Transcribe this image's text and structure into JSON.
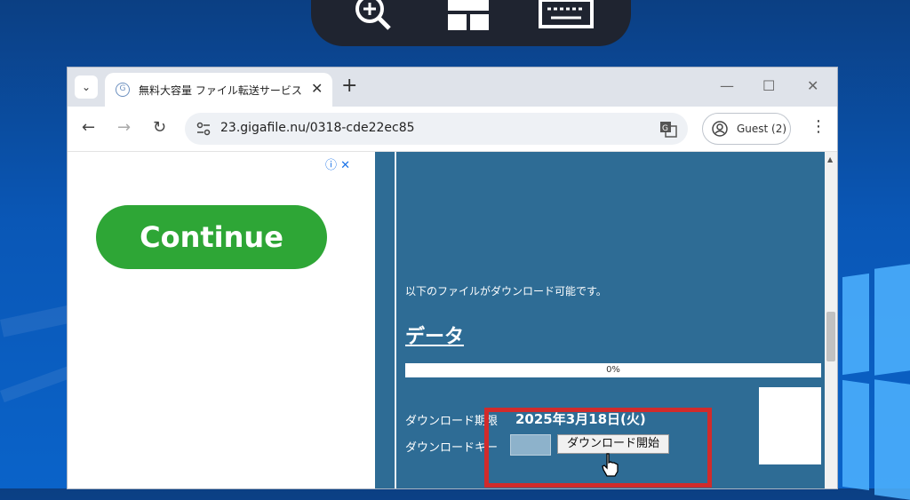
{
  "overlay_toolbar": {
    "icons": [
      "zoom-in-icon",
      "layout-icon",
      "keyboard-icon"
    ]
  },
  "browser": {
    "tab": {
      "title": "無料大容量 ファイル転送サービス G",
      "close": "✕"
    },
    "new_tab": "+",
    "window_controls": {
      "minimize": "—",
      "maximize": "☐",
      "close": "✕"
    },
    "nav": {
      "back": "←",
      "forward": "→",
      "reload": "↻"
    },
    "url": "23.gigafile.nu/0318-cde22ec85",
    "profile": {
      "label": "Guest (2)"
    },
    "menu": "⋮"
  },
  "ad": {
    "controls": "ⓘ ✕",
    "cta_label": "Continue"
  },
  "page": {
    "download_message": "以下のファイルがダウンロード可能です。",
    "file_title": "データ",
    "progress_text": "0%",
    "progress_fraction": 0.0,
    "deadline_label": "ダウンロード期限",
    "deadline_value": "2025年3月18日(火)",
    "key_label": "ダウンロードキー",
    "key_value": "",
    "download_button": "ダウンロード開始"
  },
  "colors": {
    "desktop": "#0a57b6",
    "page_bg": "#2e6c95",
    "continue_green": "#2ea636",
    "highlight_red": "#d12b2b"
  }
}
